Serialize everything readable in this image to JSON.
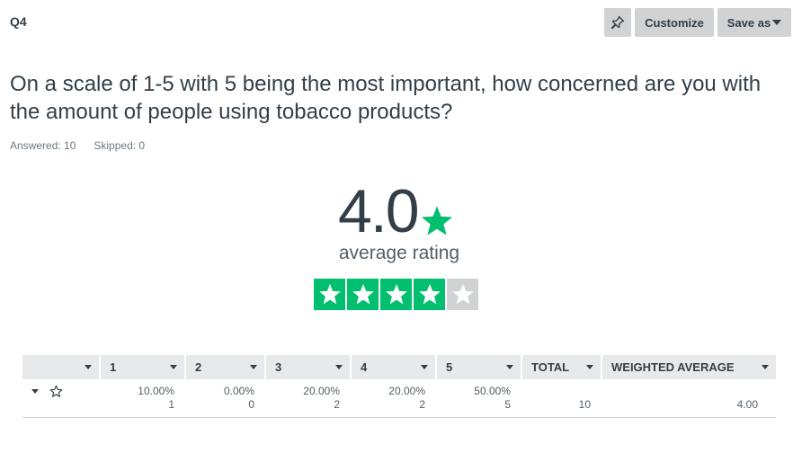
{
  "header": {
    "question_label": "Q4"
  },
  "toolbar": {
    "pin_icon": "pin-icon",
    "customize_label": "Customize",
    "save_label": "Save as"
  },
  "question": {
    "text": "On a scale of 1-5 with 5 being the most important, how concerned are you with the amount of people using tobacco products?"
  },
  "stats": {
    "answered": "Answered: 10",
    "skipped": "Skipped: 0"
  },
  "rating": {
    "value": "4.0",
    "label": "average rating",
    "stars_filled": 4,
    "stars_total": 5,
    "accent": "#00bf6f"
  },
  "table": {
    "headers": [
      "",
      "1",
      "2",
      "3",
      "4",
      "5",
      "TOTAL",
      "WEIGHTED AVERAGE"
    ],
    "row": {
      "cells": [
        {
          "pct": "10.00%",
          "count": "1"
        },
        {
          "pct": "0.00%",
          "count": "0"
        },
        {
          "pct": "20.00%",
          "count": "2"
        },
        {
          "pct": "20.00%",
          "count": "2"
        },
        {
          "pct": "50.00%",
          "count": "5"
        }
      ],
      "total": "10",
      "weighted_average": "4.00"
    }
  }
}
